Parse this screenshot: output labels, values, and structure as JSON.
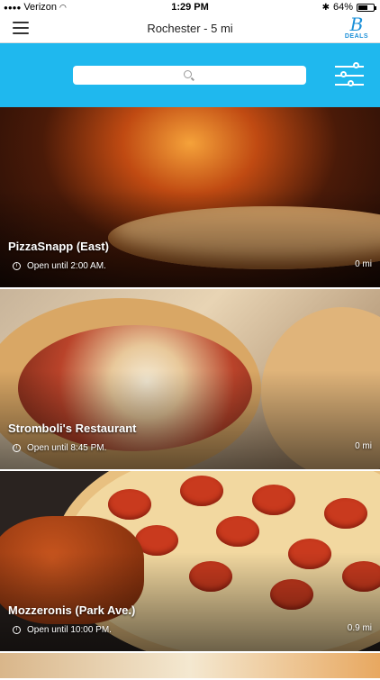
{
  "status_bar": {
    "carrier": "Verizon",
    "time": "1:29 PM",
    "battery": "64%",
    "battery_level": 0.64
  },
  "nav": {
    "title": "Rochester - 5 mi",
    "logo_letter": "B",
    "logo_text": "DEALS"
  },
  "search": {
    "placeholder": ""
  },
  "restaurants": [
    {
      "name": "PizzaSnapp (East)",
      "hours": "Open until 2:00 AM.",
      "distance": "0 mi"
    },
    {
      "name": "Stromboli's Restaurant",
      "hours": "Open until 8:45 PM.",
      "distance": "0 mi"
    },
    {
      "name": "Mozzeronis (Park Ave.)",
      "hours": "Open until 10:00 PM.",
      "distance": "0.9 mi"
    }
  ],
  "colors": {
    "accent": "#1fb8ee",
    "brand": "#1a8fd8"
  }
}
